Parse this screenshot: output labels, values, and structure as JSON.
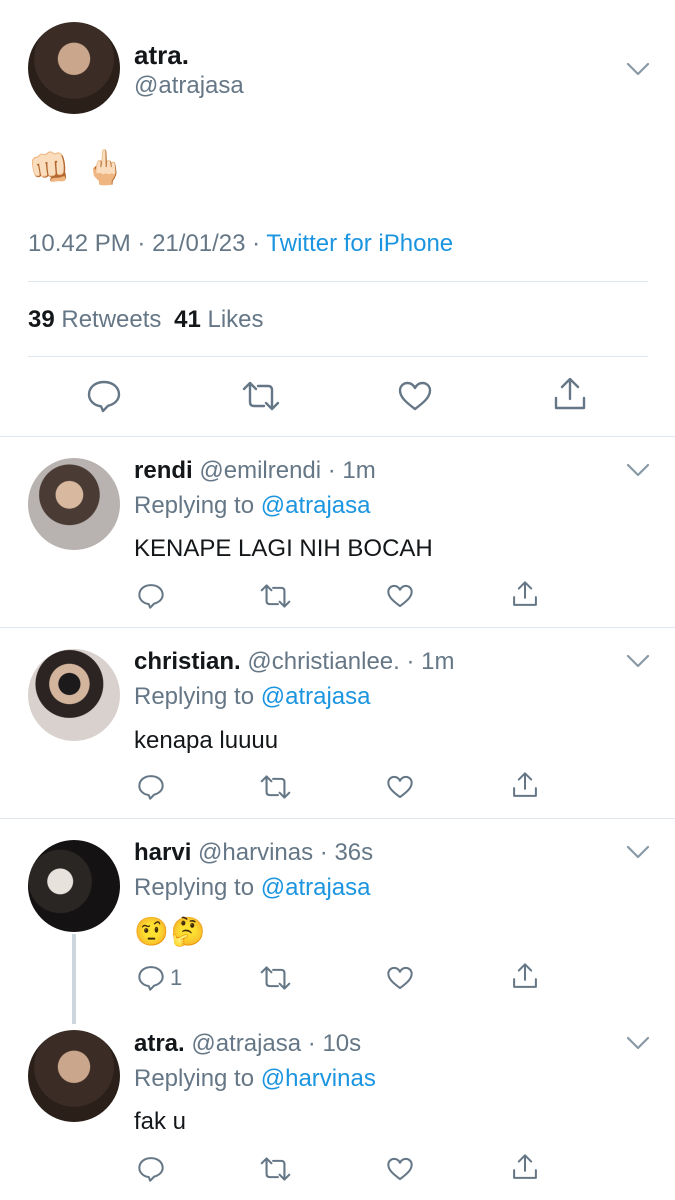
{
  "main_tweet": {
    "display_name": "atra.",
    "handle": "@atrajasa",
    "content_emoji": "👊🏻 🖕🏻",
    "time": "10.42 PM",
    "date": "21/01/23",
    "client": "Twitter for iPhone",
    "retweet_count": "39",
    "retweet_label": "Retweets",
    "like_count": "41",
    "like_label": "Likes"
  },
  "replies": [
    {
      "display_name": "rendi",
      "handle": "@emilrendi",
      "time": "1m",
      "replying_label": "Replying to",
      "replying_to": "@atrajasa",
      "text": "KENAPE LAGI NIH BOCAH",
      "reply_count": ""
    },
    {
      "display_name": "christian.",
      "handle": "@christianlee.",
      "time": "1m",
      "replying_label": "Replying to",
      "replying_to": "@atrajasa",
      "text": "kenapa luuuu",
      "reply_count": ""
    },
    {
      "display_name": "harvi",
      "handle": "@harvinas",
      "time": "36s",
      "replying_label": "Replying to",
      "replying_to": "@atrajasa",
      "text": "🤨🤔",
      "reply_count": "1"
    },
    {
      "display_name": "atra.",
      "handle": "@atrajasa",
      "time": "10s",
      "replying_label": "Replying to",
      "replying_to": "@harvinas",
      "text": "fak u",
      "reply_count": ""
    }
  ],
  "colors": {
    "link": "#1b95e0",
    "muted": "#657786",
    "divider": "#e1e8ed",
    "icon": "#657786"
  }
}
